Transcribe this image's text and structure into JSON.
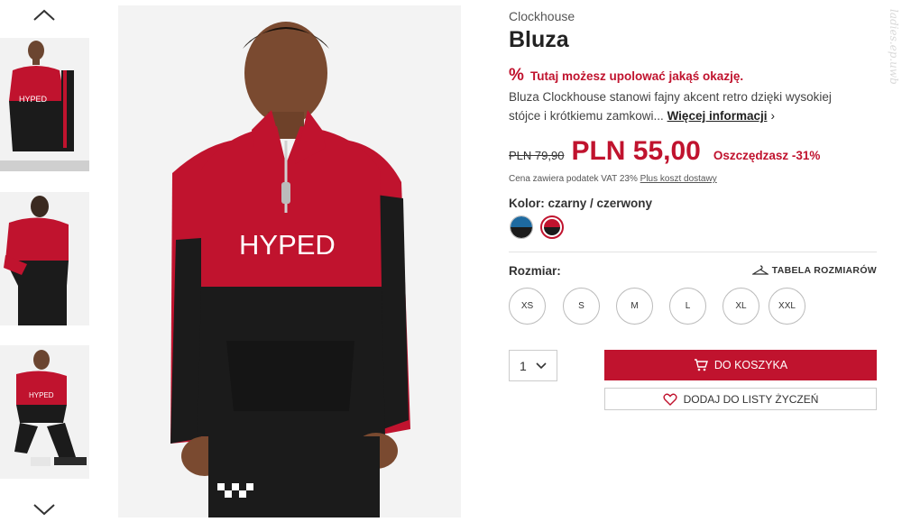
{
  "brand": "Clockhouse",
  "title": "Bluza",
  "promo": {
    "icon": "percent-icon",
    "text": "Tutaj możesz upolować jakąś okazję."
  },
  "description": {
    "text": "Bluza Clockhouse stanowi fajny akcent retro dzięki wysokiej stójce i krótkiemu zamkowi...",
    "more_label": "Więcej informacji"
  },
  "price": {
    "old": "PLN 79,90",
    "current": "PLN 55,00",
    "savings": "Oszczędzasz -31%"
  },
  "vat": {
    "text": "Cena zawiera podatek VAT 23%",
    "shipping_link": "Plus koszt dostawy"
  },
  "color": {
    "label": "Kolor: czarny / czerwony",
    "swatches": [
      {
        "name": "blue-black",
        "colors": [
          "#1e6aa0",
          "#1b1b1b"
        ]
      },
      {
        "name": "red-black",
        "colors": [
          "#c0132e",
          "#1b1b1b"
        ],
        "selected": true
      }
    ]
  },
  "size": {
    "label": "Rozmiar:",
    "table_label": "TABELA ROZMIARÓW",
    "options": [
      "XS",
      "S",
      "M",
      "L",
      "XL",
      "XXL"
    ]
  },
  "quantity": {
    "value": "1"
  },
  "buttons": {
    "add_to_cart": "DO KOSZYKA",
    "wishlist": "DODAJ DO LISTY ŻYCZEŃ"
  },
  "product_image": {
    "print_text": "HYPED"
  },
  "watermark": "ladies.ep.uwb",
  "colors": {
    "accent": "#c0132e",
    "text": "#222222",
    "muted": "#555555"
  }
}
